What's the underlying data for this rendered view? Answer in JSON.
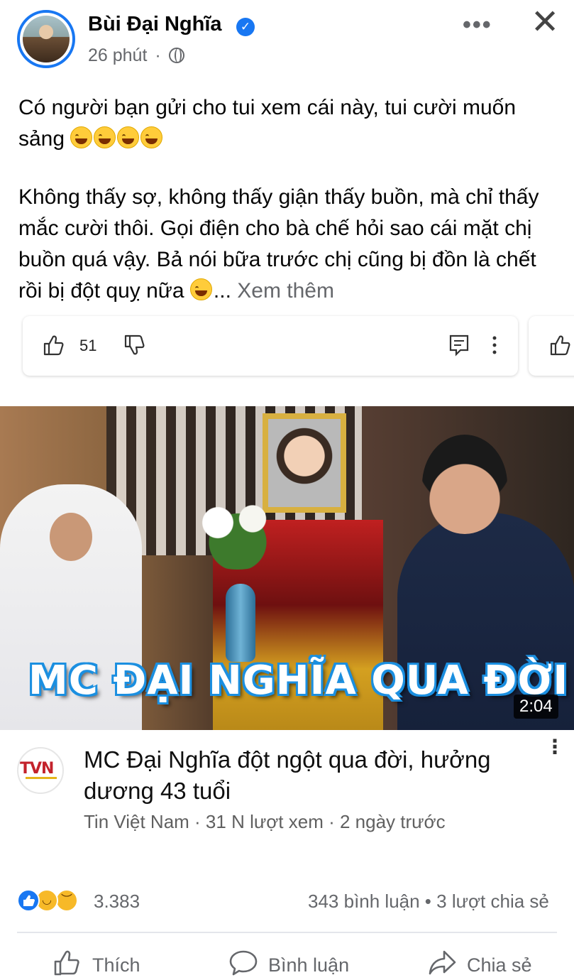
{
  "post": {
    "author": "Bùi Đại Nghĩa",
    "verified_mark": "✓",
    "time": "26 phút",
    "separator": "·",
    "more_label": "•••",
    "close_label": "✕",
    "text_line1": "Có người bạn gửi cho tui xem cái này, tui cười muốn sảng",
    "text_p2": "Không thấy sợ, không thấy giận thấy buồn, mà chỉ thấy mắc cười thôi. Gọi điện cho bà chế hỏi sao cái mặt chị buồn quá vậy. Bả nói bữa trước chị cũng bị đồn là chết rồi bị đột quỵ nữa",
    "ellipsis": "...",
    "see_more": "Xem thêm"
  },
  "embed_actions": {
    "like_count": "51"
  },
  "video": {
    "thumbnail_caption": "MC ĐẠI NGHĨA QUA ĐỜI",
    "duration": "2:04",
    "channel_logo_text": "TVN",
    "title": "MC Đại Nghĩa đột ngột qua đời, hưởng dương 43 tuổi",
    "meta": "Tin Việt Nam · 31 N lượt xem · 2 ngày trước",
    "more_label": "⋮"
  },
  "stats": {
    "reaction_count": "3.383",
    "engagement": "343 bình luận • 3 lượt chia sẻ"
  },
  "actions": {
    "like": "Thích",
    "comment": "Bình luận",
    "share": "Chia sẻ"
  },
  "colors": {
    "facebook_blue": "#1877f2",
    "secondary_text": "#65676b",
    "reaction_yellow": "#f7b928"
  }
}
